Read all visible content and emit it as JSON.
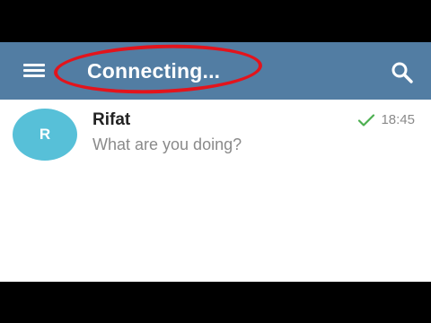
{
  "header": {
    "title": "Connecting...",
    "menu_icon": "hamburger-menu-icon",
    "search_icon": "search-icon",
    "background_color": "#527da3"
  },
  "annotation": {
    "ring_color": "#e3141c"
  },
  "chats": [
    {
      "avatar_letter": "R",
      "avatar_color": "#57c0d8",
      "name": "Rifat",
      "last_message": "What are you doing?",
      "status_icon": "single-check-icon",
      "time": "18:45"
    }
  ]
}
